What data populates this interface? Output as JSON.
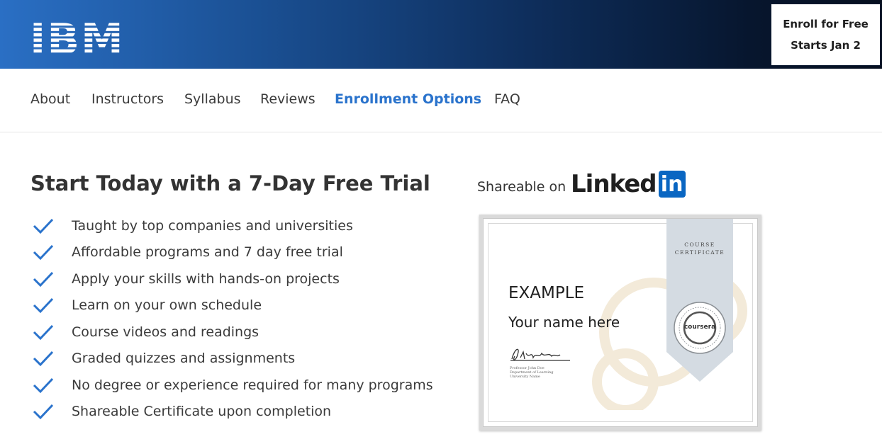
{
  "header": {
    "logo_text": "IBM",
    "enroll_button": {
      "line1": "Enroll for Free",
      "line2": "Starts Jan 2"
    }
  },
  "tabs": [
    {
      "label": "About",
      "active": false
    },
    {
      "label": "Instructors",
      "active": false
    },
    {
      "label": "Syllabus",
      "active": false
    },
    {
      "label": "Reviews",
      "active": false
    },
    {
      "label": "Enrollment Options",
      "active": true
    },
    {
      "label": "FAQ",
      "active": false
    }
  ],
  "main": {
    "heading": "Start Today with a 7-Day Free Trial",
    "features": [
      "Taught by top companies and universities",
      "Affordable programs and 7 day free trial",
      "Apply your skills with hands-on projects",
      "Learn on your own schedule",
      "Course videos and readings",
      "Graded quizzes and assignments",
      "No degree or experience required for many programs",
      "Shareable Certificate upon completion"
    ]
  },
  "share": {
    "label": "Shareable on",
    "brand_word": "Linked",
    "brand_box": "in"
  },
  "certificate": {
    "ribbon_line1": "COURSE",
    "ribbon_line2": "CERTIFICATE",
    "example": "EXAMPLE",
    "name": "Your name here",
    "seal_brand": "coursera",
    "signer_lines": [
      "Professor John Doe",
      "Department of Learning",
      "University Name"
    ]
  },
  "colors": {
    "accent": "#2a73cc",
    "check": "#2a73cc",
    "linkedin_blue": "#0a66c2",
    "banner_start": "#2a6fc4",
    "banner_end": "#060f1f"
  },
  "icons": {
    "check": "check-icon",
    "logo": "ibm-logo",
    "linkedin": "linkedin-logo"
  }
}
